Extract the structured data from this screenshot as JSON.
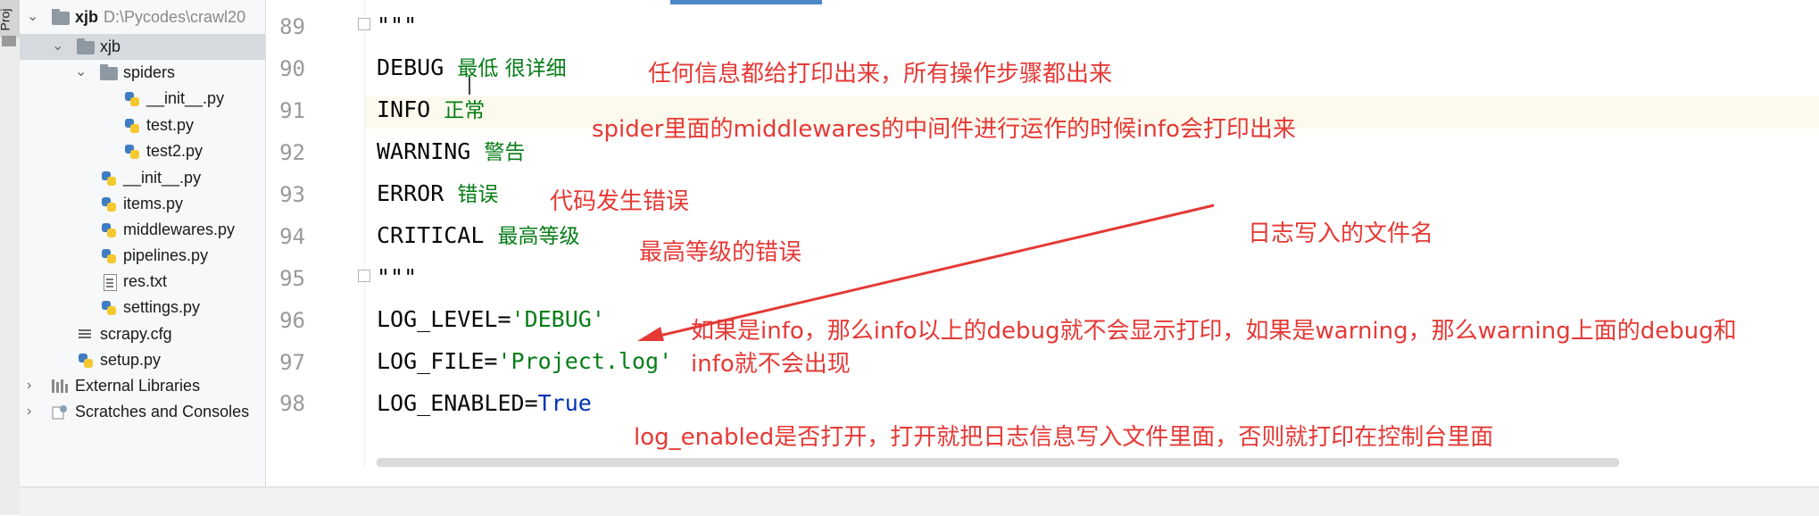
{
  "sidebar": {
    "tab_label": "Proj"
  },
  "project_tree": {
    "root": {
      "name": "xjb",
      "path": "D:\\Pycodes\\crawl20"
    },
    "items": [
      {
        "label": "xjb"
      },
      {
        "label": "spiders"
      },
      {
        "label": "__init__.py"
      },
      {
        "label": "test.py"
      },
      {
        "label": "test2.py"
      },
      {
        "label": "__init__.py"
      },
      {
        "label": "items.py"
      },
      {
        "label": "middlewares.py"
      },
      {
        "label": "pipelines.py"
      },
      {
        "label": "res.txt"
      },
      {
        "label": "settings.py"
      },
      {
        "label": "scrapy.cfg"
      },
      {
        "label": "setup.py"
      },
      {
        "label": "External Libraries"
      },
      {
        "label": "Scratches and Consoles"
      }
    ]
  },
  "editor": {
    "line_numbers": [
      "89",
      "90",
      "91",
      "92",
      "93",
      "94",
      "95",
      "96",
      "97",
      "98"
    ],
    "lines": {
      "l89": "\"\"\"",
      "l90_code": "DEBUG",
      "l90_cn": "最低 很详细",
      "l91_code": "INFO",
      "l91_cn": "正常",
      "l92_code": "WARNING",
      "l92_cn": "警告",
      "l93_code": "ERROR",
      "l93_cn": "错误",
      "l94_code": "CRITICAL",
      "l94_cn": "最高等级",
      "l95": "\"\"\"",
      "l96_a": "LOG_LEVEL=",
      "l96_b": "'DEBUG'",
      "l97_a": "LOG_FILE=",
      "l97_b": "'Project.log'",
      "l98_a": "LOG_ENABLED=",
      "l98_b": "True"
    }
  },
  "annotations": {
    "debug_note": "任何信息都给打印出来，所有操作步骤都出来",
    "info_note": "spider里面的middlewares的中间件进行运作的时候info会打印出来",
    "error_note": "代码发生错误",
    "critical_note": "最高等级的错误",
    "logfile_note": "日志写入的文件名",
    "level_note_line1": "如果是info，那么info以上的debug就不会显示打印，如果是warning，那么warning上面的debug和",
    "level_note_line2": "info就不会出现",
    "enabled_note": "log_enabled是否打开，打开就把日志信息写入文件里面，否则就打印在控制台里面"
  },
  "colors": {
    "annotation": "#e53935",
    "string": "#067d17",
    "keyword": "#0033b3",
    "current_line": "#fcfaed"
  }
}
